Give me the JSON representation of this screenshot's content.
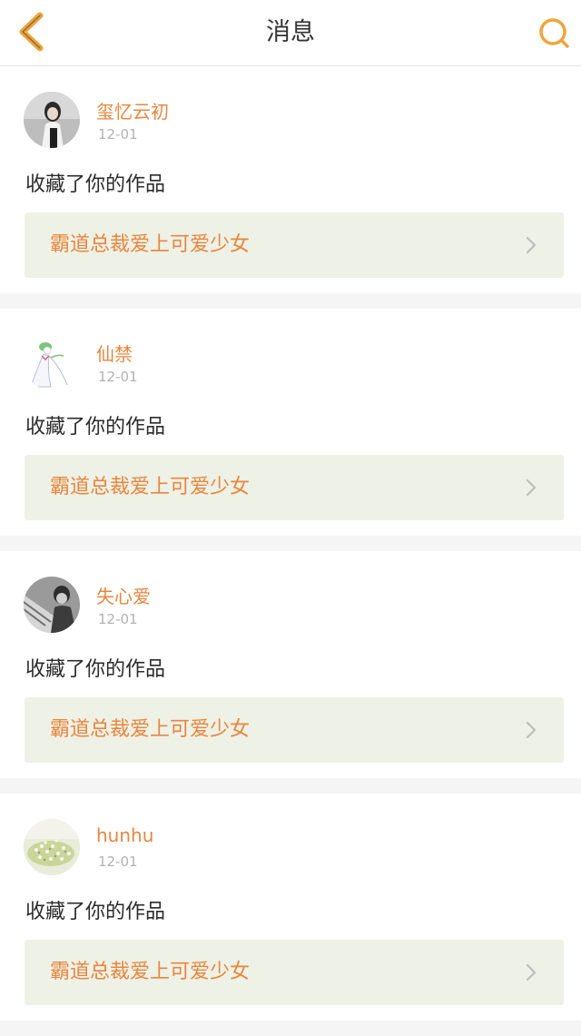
{
  "header": {
    "title": "消息",
    "accent_color": "#f0a43b"
  },
  "messages": [
    {
      "username": "玺忆云初",
      "date": "12-01",
      "action": "收藏了你的作品",
      "work_title": "霸道总裁爱上可爱少女",
      "avatar_icon": "avatar-girl-photo"
    },
    {
      "username": "仙禁",
      "date": "12-01",
      "action": "收藏了你的作品",
      "work_title": "霸道总裁爱上可爱少女",
      "avatar_icon": "avatar-gardevoir"
    },
    {
      "username": "失心爱",
      "date": "12-01",
      "action": "收藏了你的作品",
      "work_title": "霸道总裁爱上可爱少女",
      "avatar_icon": "avatar-grayscale-photo"
    },
    {
      "username": "hunhu",
      "date": "12-01",
      "action": "收藏了你的作品",
      "work_title": "霸道总裁爱上可爱少女",
      "avatar_icon": "avatar-flowers-photo"
    }
  ]
}
